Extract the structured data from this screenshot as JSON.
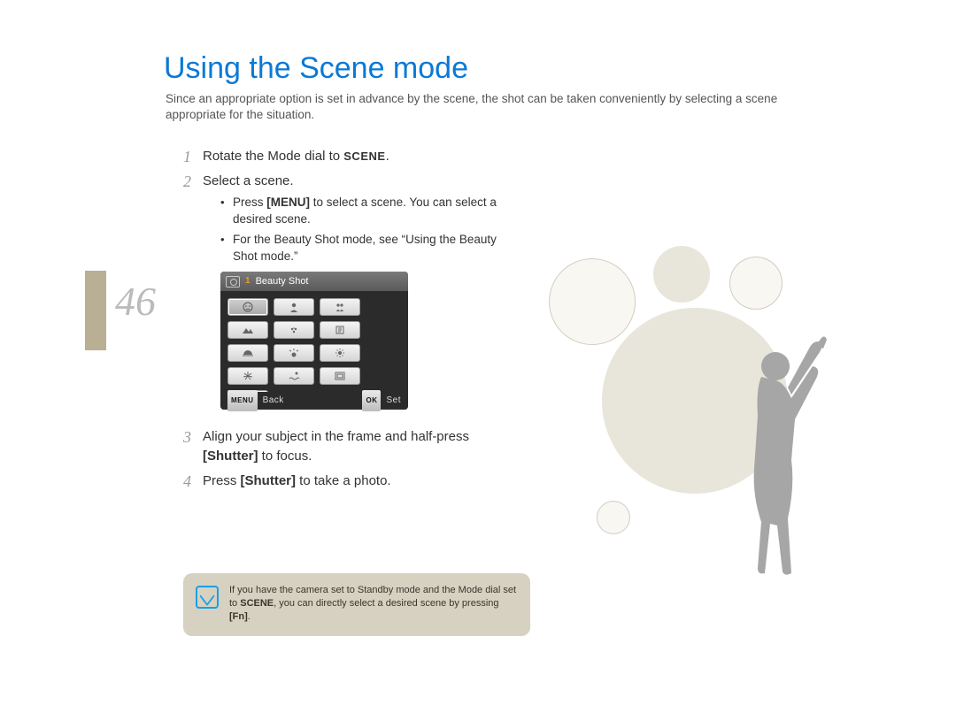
{
  "pageNumber": "46",
  "title": "Using the Scene mode",
  "intro": "Since an appropriate option is set in advance by the scene, the shot can be taken conveniently by selecting a scene appropriate for the situation.",
  "steps": {
    "s1_pre": "Rotate the Mode dial to ",
    "s1_badge": "SCENE",
    "s1_post": ".",
    "s2": "Select a scene.",
    "s2_bullet1_pre": "Press ",
    "s2_bullet1_bold": "[MENU]",
    "s2_bullet1_post": " to select a scene. You can select a desired scene.",
    "s2_bullet2": "For the Beauty Shot mode, see “Using the Beauty Shot mode.”",
    "s3_pre": "Align your subject in the frame and half-press ",
    "s3_bold": "[Shutter]",
    "s3_post": " to focus.",
    "s4_pre": "Press ",
    "s4_bold": "[Shutter]",
    "s4_post": " to take a photo."
  },
  "nums": {
    "n1": "1",
    "n2": "2",
    "n3": "3",
    "n4": "4"
  },
  "lcd": {
    "tabIndex": "1",
    "headerTitle": "Beauty Shot",
    "footer": {
      "menuBadge": "MENU",
      "back": "Back",
      "okBadge": "OK",
      "set": "Set"
    },
    "icons": [
      "face",
      "portrait",
      "children",
      "landscape",
      "closeup",
      "text",
      "sunset",
      "dawn",
      "backlight",
      "fireworks",
      "beach",
      "frame",
      "night"
    ]
  },
  "note": {
    "pre": "If you have the camera set to Standby mode and the Mode dial set to ",
    "badge": "SCENE",
    "mid": ", you can directly select a desired scene by pressing ",
    "fn": "[Fn]",
    "post": "."
  }
}
